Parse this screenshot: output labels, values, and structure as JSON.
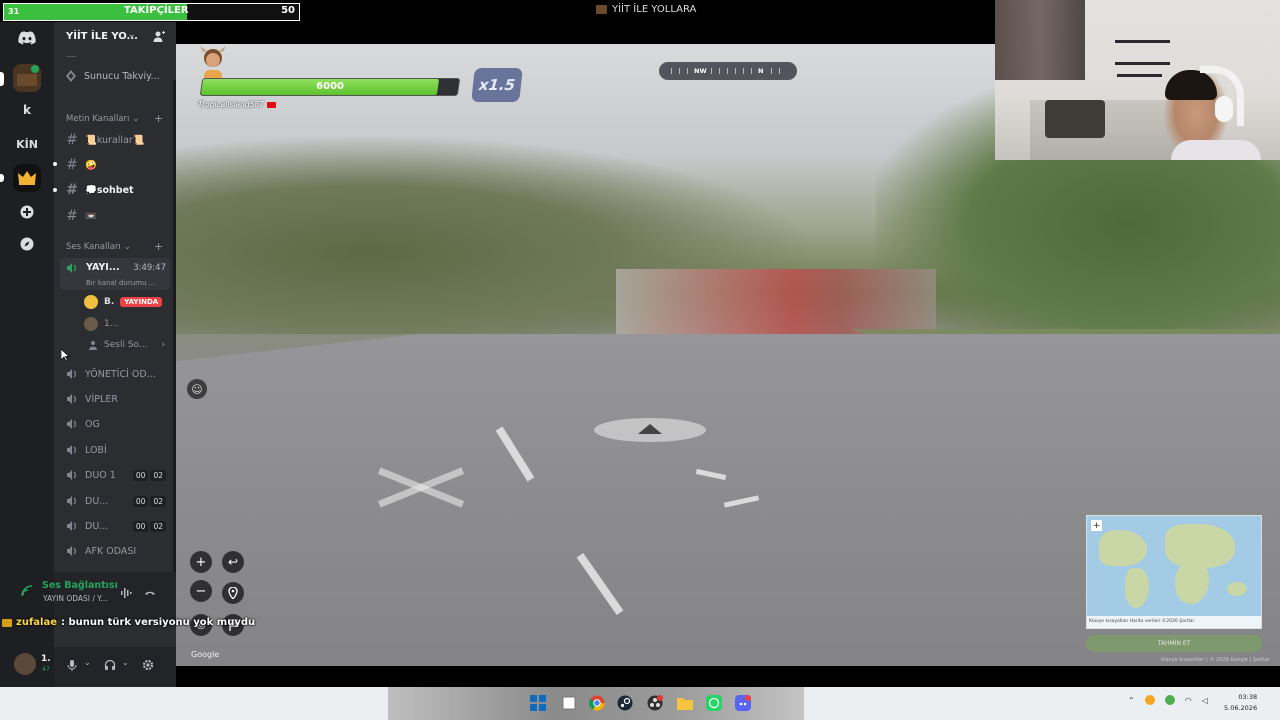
{
  "overlay": {
    "follow_left": "31",
    "follow_title": "TAKİPÇİLER",
    "follow_goal": "50",
    "follow_progress": 0.62,
    "window_title": "YİİT İLE YOLLARA"
  },
  "rail": {
    "k_label": "k",
    "kin_label": "KİN"
  },
  "server": {
    "name": "YİİT İLE YO...",
    "boost_label": "Sunucu Takviy..."
  },
  "text_category": {
    "label": "Metin Kanalları",
    "channels": [
      {
        "name": "📜kurallar📜"
      },
      {
        "name": "🤪"
      },
      {
        "name": "💭sohbet"
      },
      {
        "name": "📼"
      }
    ]
  },
  "voice_category": {
    "label": "Ses Kanalları",
    "active": {
      "name": "YAYI...",
      "time": "3:49:47",
      "status": "Bir kanal durumu ..."
    },
    "members": [
      {
        "name": "B.",
        "badge": "YAYINDA"
      },
      {
        "name": "1..."
      }
    ],
    "soundboard": "Sesli So...",
    "channels": [
      {
        "name": "YÖNETİCİ OD..."
      },
      {
        "name": "VİPLER"
      },
      {
        "name": "OG"
      },
      {
        "name": "LOBİ"
      },
      {
        "name": "DUO 1",
        "c1": "00",
        "c2": "02"
      },
      {
        "name": "DU...",
        "c1": "00",
        "c2": "02"
      },
      {
        "name": "DU...",
        "c1": "00",
        "c2": "02"
      },
      {
        "name": "AFK ODASI"
      }
    ]
  },
  "voice_connection": {
    "title": "Ses Bağlantısı",
    "subtitle": "YAYIN ODASI / Y..."
  },
  "user": {
    "name": "1.",
    "tag": "47"
  },
  "chat": {
    "username": "zufalae",
    "message": ": bunun türk versiyonu yok muydu"
  },
  "game": {
    "health": "6000",
    "health_fraction": 0.92,
    "multiplier": "x1.5",
    "player_name": "TropicalIsland587",
    "compass_nw": "NW",
    "compass_n": "N",
    "google": "Google",
    "minimap_footer": "Klavye kısayolları   Harita verileri ©2026   Şartlar",
    "guess_label": "TAHMİN ET",
    "map_footer": "Klavye kısayolları | © 2026 Google | Şartlar"
  },
  "taskbar": {
    "time": "03:38",
    "date": "5.06.2026"
  },
  "colors": {
    "discord_green": "#23a55a",
    "live_red": "#ed4245",
    "health_green": "#5cc22f",
    "follow_green": "#3bbf3e"
  }
}
